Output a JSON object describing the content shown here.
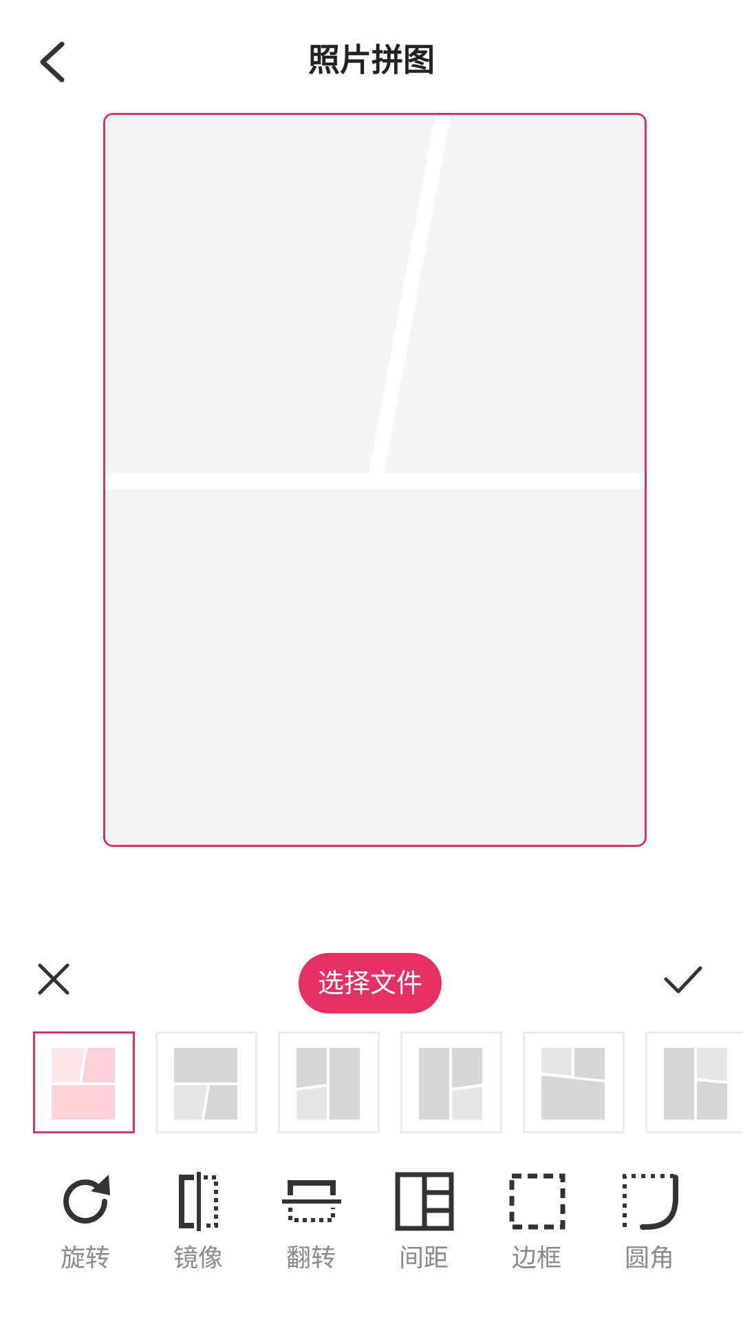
{
  "header": {
    "title": "照片拼图"
  },
  "action_bar": {
    "select_file_label": "选择文件"
  },
  "colors": {
    "accent": "#e53064",
    "border": "#d5336b",
    "cell": "#f5f5f5"
  },
  "layouts": {
    "selected_index": 0,
    "count_visible": 6
  },
  "tools": [
    {
      "label": "旋转",
      "icon": "rotate-icon"
    },
    {
      "label": "镜像",
      "icon": "mirror-icon"
    },
    {
      "label": "翻转",
      "icon": "flip-icon"
    },
    {
      "label": "间距",
      "icon": "spacing-icon"
    },
    {
      "label": "边框",
      "icon": "border-icon"
    },
    {
      "label": "圆角",
      "icon": "corner-radius-icon"
    }
  ]
}
